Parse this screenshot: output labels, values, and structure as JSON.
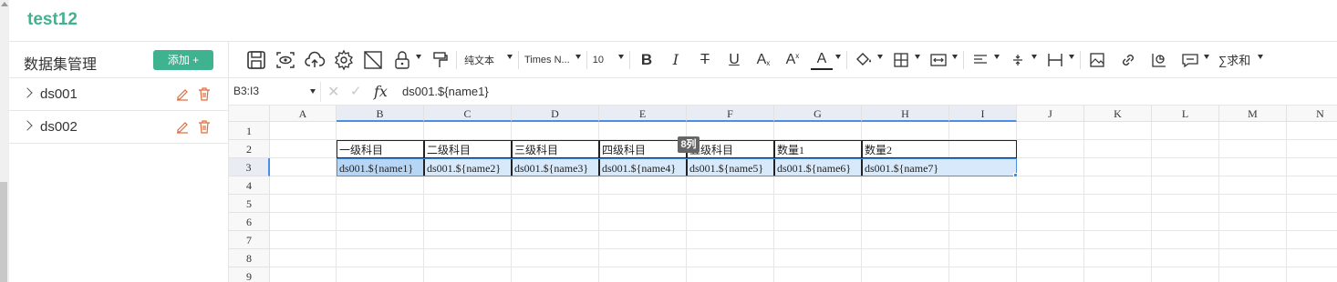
{
  "app": {
    "title": "test12"
  },
  "datasets": {
    "title": "数据集管理",
    "add_label": "添加 +",
    "items": [
      {
        "label": "ds001"
      },
      {
        "label": "ds002"
      }
    ]
  },
  "toolbar": {
    "text_format": "纯文本",
    "font_family": "Times N...",
    "font_size": "10",
    "sum_label": "∑求和"
  },
  "formula_bar": {
    "cell_ref": "B3:I3",
    "fx_label": "fx",
    "value": "ds001.${name1}"
  },
  "grid": {
    "columns": [
      "A",
      "B",
      "C",
      "D",
      "E",
      "F",
      "G",
      "H",
      "I",
      "J",
      "K",
      "L",
      "M",
      "N"
    ],
    "rows": [
      "1",
      "2",
      "3",
      "4",
      "5",
      "6",
      "7",
      "8",
      "9"
    ],
    "row2": [
      "一级科目",
      "二级科目",
      "三级科目",
      "四级科目",
      "五级科目",
      "数量1",
      "数量2"
    ],
    "row3": [
      "ds001.${name1}",
      "ds001.${name2}",
      "ds001.${name3}",
      "ds001.${name4}",
      "ds001.${name5}",
      "ds001.${name6}",
      "ds001.${name7}"
    ],
    "col_tooltip": "8列"
  },
  "colors": {
    "brand": "#3fb28f",
    "selection": "#4a90e2",
    "icon_accent": "#e06c3c"
  }
}
